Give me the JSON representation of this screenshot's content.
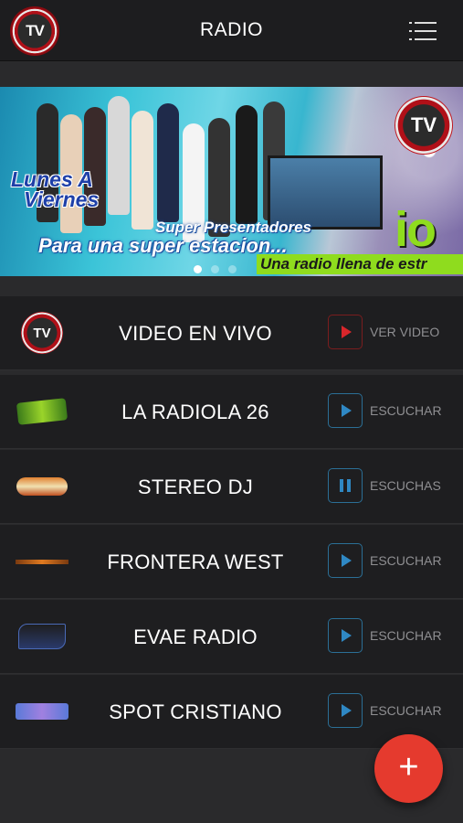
{
  "header": {
    "title": "RADIO",
    "logo_text": "TV",
    "menu_icon": "list-menu-icon"
  },
  "banner": {
    "line1": "Lunes A",
    "line2": "Viernes",
    "line3": "Super Presentadores",
    "line4": "Para una super estacion...",
    "side_word": "io",
    "strip_text": "Una radio llena de estr",
    "logo_text": "TV",
    "pager": {
      "count": 3,
      "active": 0
    }
  },
  "stations": [
    {
      "name": "VIDEO EN VIVO",
      "action": "VER VIDEO",
      "state": "play",
      "accent": "#d8262b",
      "logo": "radionet-tv-logo"
    },
    {
      "name": "LA RADIOLA 26",
      "action": "ESCUCHAR",
      "state": "play",
      "accent": "#2f88c4",
      "logo": "la-radiola-logo"
    },
    {
      "name": "STEREO DJ",
      "action": "ESCUCHAS",
      "state": "pause",
      "accent": "#2f88c4",
      "logo": "stereo-dj-logo"
    },
    {
      "name": "FRONTERA WEST",
      "action": "ESCUCHAR",
      "state": "play",
      "accent": "#2f88c4",
      "logo": "frontera-west-logo"
    },
    {
      "name": "EVAE RADIO",
      "action": "ESCUCHAR",
      "state": "play",
      "accent": "#2f88c4",
      "logo": "evae-radio-logo"
    },
    {
      "name": "SPOT CRISTIANO",
      "action": "ESCUCHAR",
      "state": "play",
      "accent": "#2f88c4",
      "logo": "spot-cristiano-logo"
    }
  ],
  "fab": {
    "label": "+"
  },
  "colors": {
    "fab": "#e53a2e",
    "play": "#2f88c4",
    "live": "#d8262b",
    "row_bg": "#1e1e20"
  }
}
